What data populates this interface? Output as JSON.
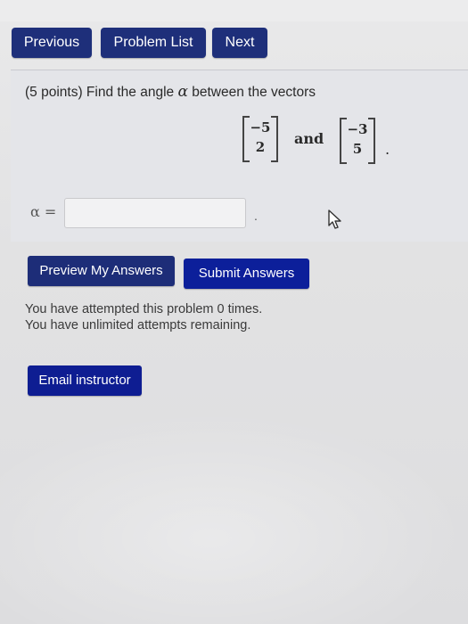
{
  "nav": {
    "previous_label": "Previous",
    "problem_list_label": "Problem List",
    "next_label": "Next"
  },
  "problem": {
    "points_prefix": "(5 points) Find the angle ",
    "alpha_symbol": "α",
    "points_suffix": " between the vectors",
    "vector1": {
      "top": "−5",
      "bottom": "2"
    },
    "vector2": {
      "top": "−3",
      "bottom": "5"
    },
    "and_word": "and",
    "period": "."
  },
  "answer": {
    "label": "α =",
    "value": "",
    "placeholder": "",
    "trailing_dot": "."
  },
  "actions": {
    "preview_label": "Preview My Answers",
    "submit_label": "Submit Answers",
    "email_label": "Email instructor"
  },
  "status": {
    "attempts_line": "You have attempted this problem 0 times.",
    "remaining_line": "You have unlimited attempts remaining."
  },
  "icons": {
    "cursor": "mouse-pointer-icon"
  },
  "colors": {
    "nav_button": "#1e2f7a",
    "submit_button": "#0c1f9a",
    "panel_bg": "#e4e5e9"
  }
}
